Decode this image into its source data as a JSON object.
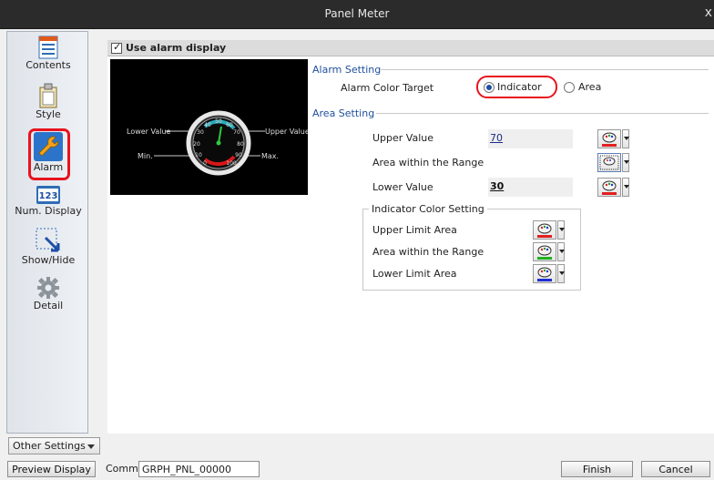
{
  "window": {
    "title": "Panel Meter",
    "close_glyph": "x"
  },
  "sidebar": {
    "items": [
      {
        "label": "Contents",
        "icon": "contents-icon"
      },
      {
        "label": "Style",
        "icon": "style-icon"
      },
      {
        "label": "Alarm",
        "icon": "wrench-icon",
        "selected": true
      },
      {
        "label": "Num. Display",
        "icon": "num-display-icon",
        "icon_text": "123"
      },
      {
        "label": "Show/Hide",
        "icon": "show-hide-icon"
      },
      {
        "label": "Detail",
        "icon": "gear-icon"
      }
    ],
    "other_settings": "Other Settings"
  },
  "main": {
    "use_alarm_display": {
      "label": "Use alarm display",
      "checked": true
    },
    "preview": {
      "lower_value": "Lower Value",
      "upper_value": "Upper Value",
      "min": "Min.",
      "max": "Max.",
      "scale_ticks": [
        "0",
        "10",
        "20",
        "30",
        "40",
        "50",
        "60",
        "70",
        "80",
        "90",
        "100"
      ]
    },
    "alarm_setting": {
      "section": "Alarm Setting",
      "target_label": "Alarm Color Target",
      "options": [
        "Indicator",
        "Area"
      ],
      "selected": "Indicator"
    },
    "area_setting": {
      "section": "Area Setting",
      "rows": [
        {
          "label": "Upper Value",
          "value": "70"
        },
        {
          "label": "Area within the Range",
          "value": ""
        },
        {
          "label": "Lower Value",
          "value": "30"
        }
      ]
    },
    "indicator_color_setting": {
      "title": "Indicator Color Setting",
      "rows": [
        {
          "label": "Upper Limit Area",
          "color": "#e02020"
        },
        {
          "label": "Area within the Range",
          "color": "#20b020"
        },
        {
          "label": "Lower Limit Area",
          "color": "#2030d0"
        }
      ]
    }
  },
  "statusbar": {
    "preview_button": "Preview Display",
    "comm_label": "Comm",
    "comm_value": "GRPH_PNL_00000",
    "finish_button": "Finish",
    "cancel_button": "Cancel"
  },
  "colors": {
    "accent": "#1f4f9c",
    "highlight": "#e8131d",
    "dial_teal": "#2aa8b8",
    "dial_red": "#d81818"
  }
}
